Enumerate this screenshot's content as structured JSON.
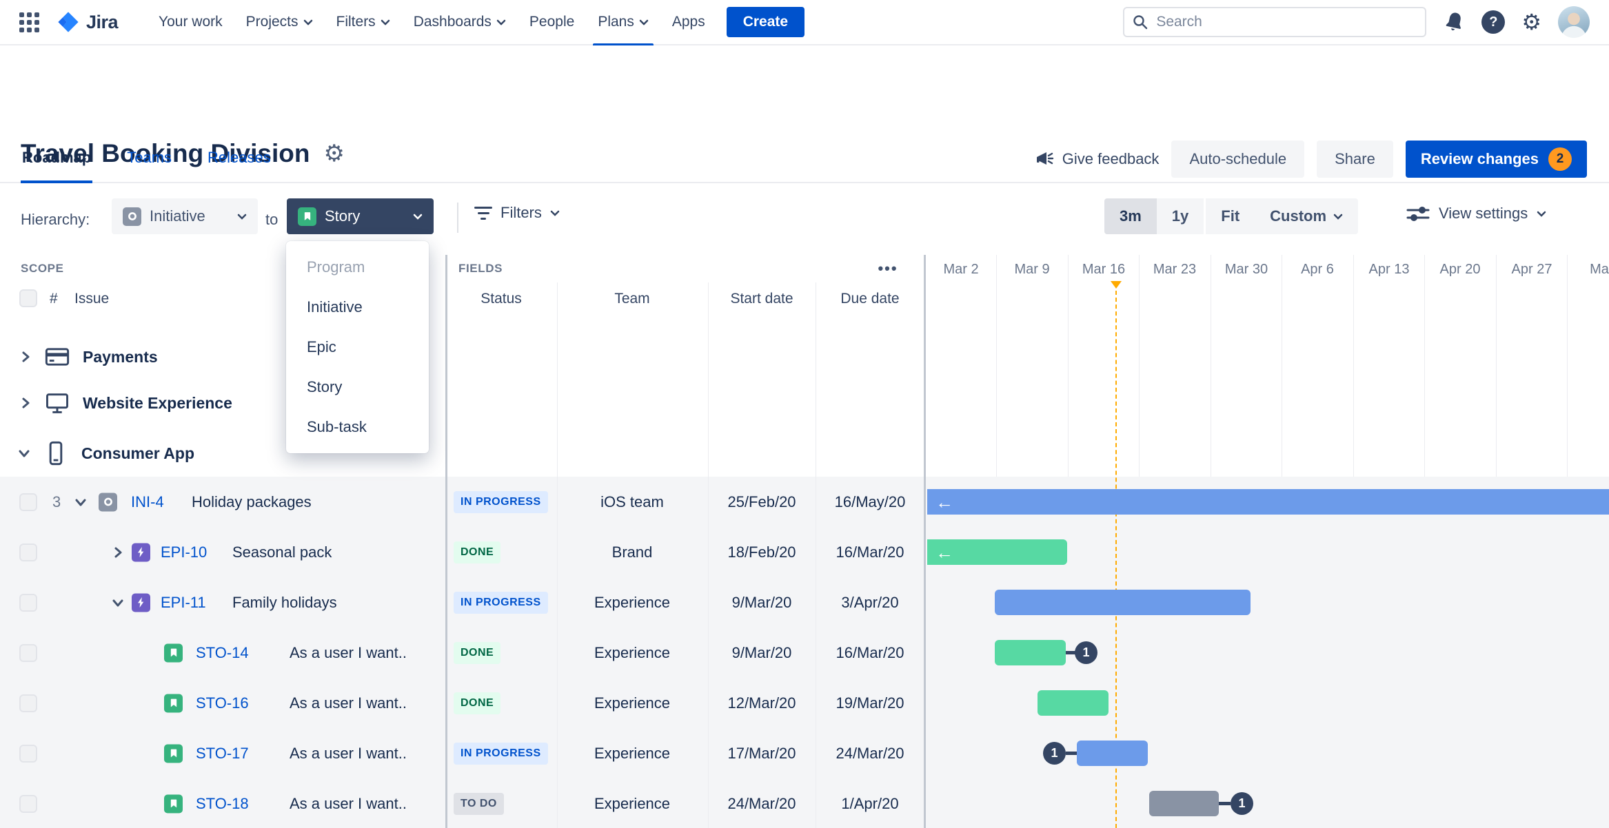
{
  "nav": {
    "logo_text": "Jira",
    "items": [
      {
        "label": "Your work",
        "chevron": false
      },
      {
        "label": "Projects",
        "chevron": true
      },
      {
        "label": "Filters",
        "chevron": true
      },
      {
        "label": "Dashboards",
        "chevron": true
      },
      {
        "label": "People",
        "chevron": false
      },
      {
        "label": "Plans",
        "chevron": true,
        "active": true
      },
      {
        "label": "Apps",
        "chevron": false
      }
    ],
    "create_label": "Create",
    "search_placeholder": "Search",
    "help_glyph": "?",
    "gear_glyph": "⚙"
  },
  "header": {
    "title": "Travel Booking Division",
    "give_feedback": "Give feedback",
    "auto_schedule": "Auto-schedule",
    "share": "Share",
    "review_changes": "Review changes",
    "review_count": "2"
  },
  "tabs": [
    {
      "label": "Roadmap",
      "active": true
    },
    {
      "label": "Teams"
    },
    {
      "label": "Releases"
    }
  ],
  "toolbar": {
    "hierarchy_label": "Hierarchy:",
    "from_value": "Initiative",
    "to_word": "to",
    "to_value": "Story",
    "filters_label": "Filters",
    "zoom": [
      "3m",
      "1y",
      "Fit",
      "Custom"
    ],
    "zoom_active": "3m",
    "view_settings_label": "View settings"
  },
  "type_menu": {
    "items": [
      "Program",
      "Initiative",
      "Epic",
      "Story",
      "Sub-task"
    ],
    "disabled_item": "Program"
  },
  "scope": {
    "label": "SCOPE",
    "hash_col": "#",
    "issue_col": "Issue",
    "groups": [
      "Payments",
      "Website Experience",
      "Consumer App"
    ]
  },
  "fields": {
    "label": "FIELDS",
    "more_glyph": "•••",
    "columns": [
      "Status",
      "Team",
      "Start date",
      "Due date"
    ]
  },
  "rows": [
    {
      "count": "3",
      "key": "INI-4",
      "title": "Holiday packages",
      "type": "initiative",
      "status": "IN PROGRESS",
      "status_kind": "inprogress",
      "team": "iOS team",
      "start": "25/Feb/20",
      "due": "16/May/20",
      "bar": {
        "kind": "blue",
        "clipped_left": true,
        "clipped_right": true
      }
    },
    {
      "key": "EPI-10",
      "title": "Seasonal pack",
      "type": "epic",
      "status": "DONE",
      "status_kind": "done",
      "team": "Brand",
      "start": "18/Feb/20",
      "due": "16/Mar/20",
      "bar": {
        "kind": "green",
        "clipped_left": true
      }
    },
    {
      "key": "EPI-11",
      "title": "Family holidays",
      "type": "epic",
      "status": "IN PROGRESS",
      "status_kind": "inprogress",
      "team": "Experience",
      "start": "9/Mar/20",
      "due": "3/Apr/20",
      "bar": {
        "kind": "blue"
      }
    },
    {
      "key": "STO-14",
      "title": "As a user I want..",
      "type": "story",
      "status": "DONE",
      "status_kind": "done",
      "team": "Experience",
      "start": "9/Mar/20",
      "due": "16/Mar/20",
      "bar": {
        "kind": "green",
        "badge": "1",
        "badge_side": "right"
      }
    },
    {
      "key": "STO-16",
      "title": "As a user I want..",
      "type": "story",
      "status": "DONE",
      "status_kind": "done",
      "team": "Experience",
      "start": "12/Mar/20",
      "due": "19/Mar/20",
      "bar": {
        "kind": "green"
      }
    },
    {
      "key": "STO-17",
      "title": "As a user I want..",
      "type": "story",
      "status": "IN PROGRESS",
      "status_kind": "inprogress",
      "team": "Experience",
      "start": "17/Mar/20",
      "due": "24/Mar/20",
      "bar": {
        "kind": "blue",
        "badge": "1",
        "badge_side": "left"
      }
    },
    {
      "key": "STO-18",
      "title": "As a user I want..",
      "type": "story",
      "status": "TO DO",
      "status_kind": "todo",
      "team": "Experience",
      "start": "24/Mar/20",
      "due": "1/Apr/20",
      "bar": {
        "kind": "grey",
        "badge": "1",
        "badge_side": "right"
      }
    }
  ],
  "timeline": {
    "weeks": [
      "Mar 2",
      "Mar 9",
      "Mar 16",
      "Mar 23",
      "Mar 30",
      "Apr 6",
      "Apr 13",
      "Apr 20",
      "Apr 27",
      "May"
    ],
    "today_color": "#FFAB00"
  },
  "icons": {
    "arrow_left": "←"
  },
  "colors": {
    "accent": "#0052CC",
    "bar_blue": "#6C9BEA",
    "bar_green": "#57D9A3",
    "bar_grey": "#8993A4",
    "today": "#FFAB00",
    "review_badge": "#FF991F",
    "status_inprogress_bg": "#DEEBFF",
    "status_done_bg": "#E3FCEF",
    "status_todo_bg": "#DFE1E6"
  }
}
